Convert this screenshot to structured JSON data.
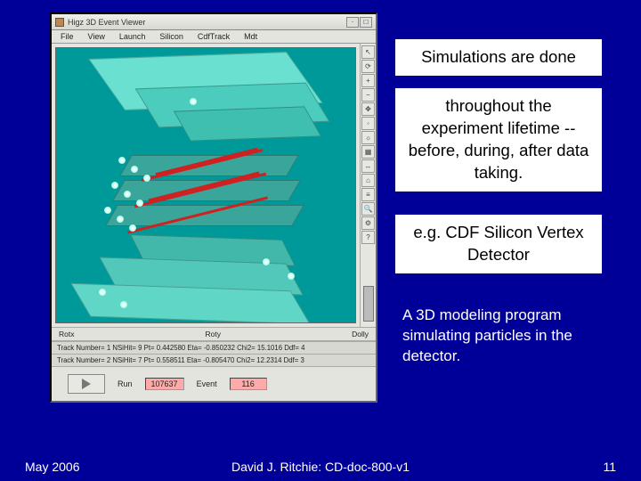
{
  "viewer": {
    "title": "Higz 3D Event Viewer",
    "menus": [
      "File",
      "View",
      "Launch",
      "Silicon",
      "CdfTrack",
      "Mdt"
    ],
    "palette_icons": [
      "arrow-icon",
      "rotate-icon",
      "zoom-in-icon",
      "zoom-out-icon",
      "pan-icon",
      "pick-icon",
      "light-icon",
      "shade-icon",
      "measure-icon",
      "reset-icon",
      "pref-icon",
      "mag-icon",
      "cfg-icon",
      "help-icon"
    ],
    "status": {
      "rot_x": "Rotx",
      "rot_y": "Roty",
      "dolly": "Dolly"
    },
    "info_line1": "Track Number= 1   NSiHit= 9   Pt= 0.442580   Eta= -0.850232   Chi2= 15.1016   Ddf= 4",
    "info_line2": "Track Number= 2   NSiHit= 7   Pt= 0.558511   Eta= -0.805470   Chi2= 12.2314   Ddf= 3",
    "controls": {
      "run_label": "Run",
      "run_value": "107637",
      "event_label": "Event",
      "event_value": "116"
    }
  },
  "text": {
    "box1": "Simulations are done",
    "box2": "throughout the experiment lifetime -- before, during, after data taking.",
    "box3": "e.g. CDF Silicon Vertex Detector",
    "caption": "A 3D modeling program simulating particles in the detector."
  },
  "footer": {
    "left": "May 2006",
    "center": "David J. Ritchie: CD-doc-800-v1",
    "page": "11"
  }
}
